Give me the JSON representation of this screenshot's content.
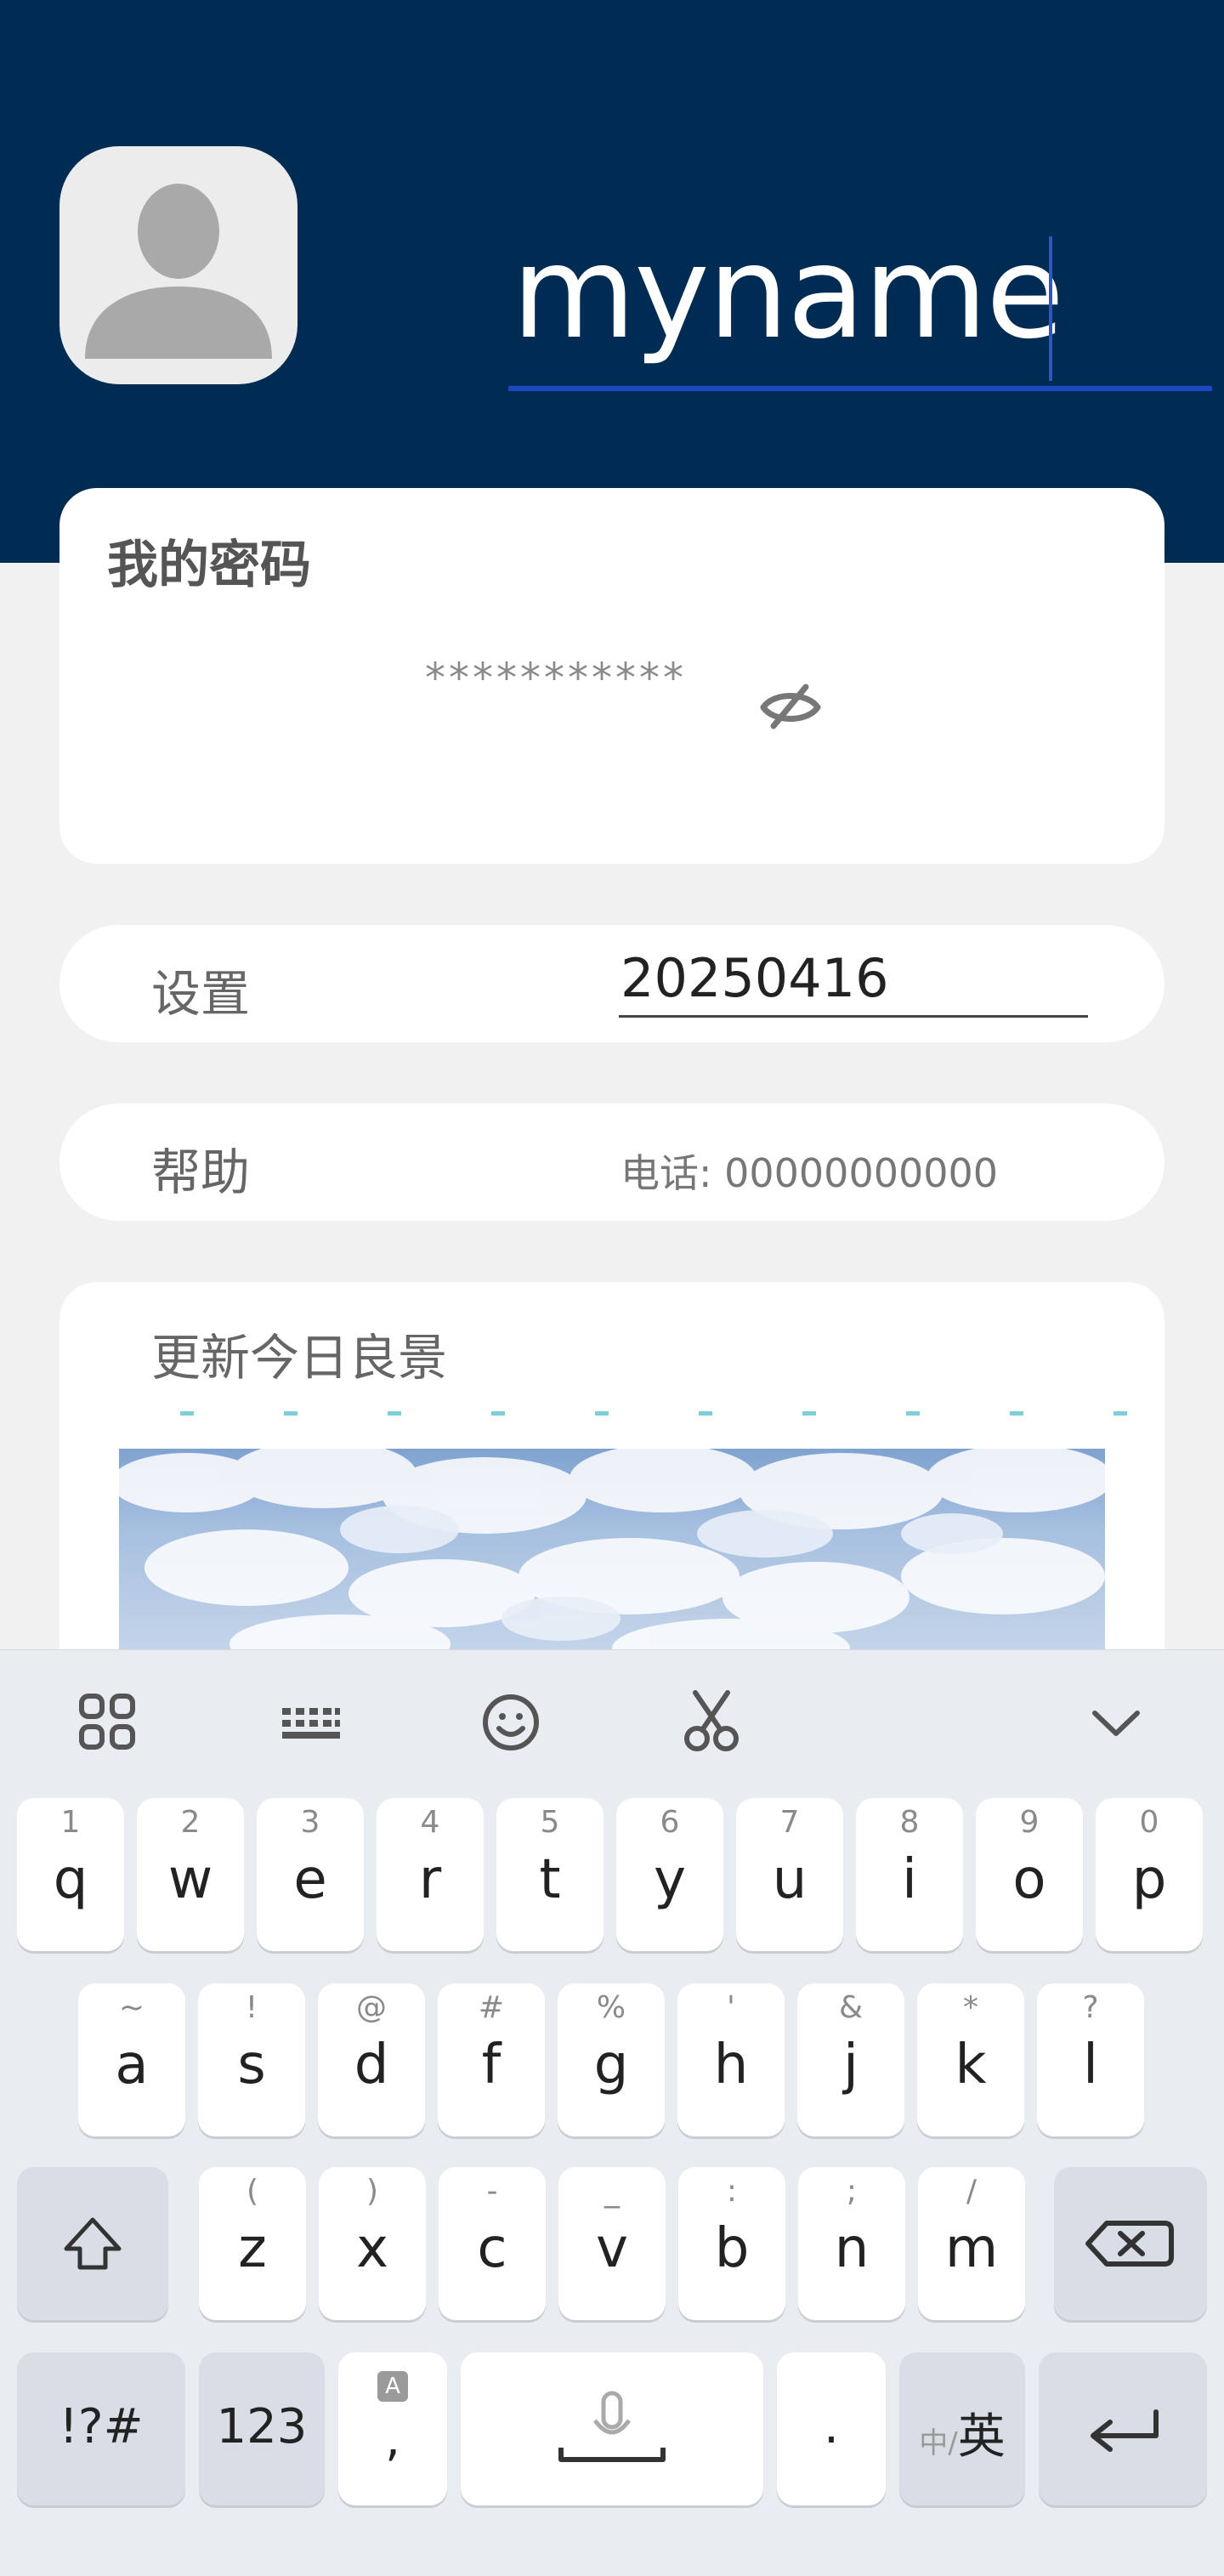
{
  "header": {
    "username": "myname"
  },
  "password_card": {
    "title": "我的密码",
    "masked_value": "***********"
  },
  "settings_row": {
    "label": "设置",
    "value": "20250416"
  },
  "help_row": {
    "label": "帮助",
    "phone": "电话: 00000000000"
  },
  "scenery_card": {
    "title": "更新今日良景"
  },
  "keyboard": {
    "toolbar": [
      "grid-menu-icon",
      "keyboard-layout-icon",
      "emoji-icon",
      "clipboard-scissors-icon",
      "collapse-keyboard-icon"
    ],
    "row1": [
      {
        "k": "q",
        "h": "1"
      },
      {
        "k": "w",
        "h": "2"
      },
      {
        "k": "e",
        "h": "3"
      },
      {
        "k": "r",
        "h": "4"
      },
      {
        "k": "t",
        "h": "5"
      },
      {
        "k": "y",
        "h": "6"
      },
      {
        "k": "u",
        "h": "7"
      },
      {
        "k": "i",
        "h": "8"
      },
      {
        "k": "o",
        "h": "9"
      },
      {
        "k": "p",
        "h": "0"
      }
    ],
    "row2": [
      {
        "k": "a",
        "h": "~"
      },
      {
        "k": "s",
        "h": "!"
      },
      {
        "k": "d",
        "h": "@"
      },
      {
        "k": "f",
        "h": "#"
      },
      {
        "k": "g",
        "h": "%"
      },
      {
        "k": "h",
        "h": "'"
      },
      {
        "k": "j",
        "h": "&"
      },
      {
        "k": "k",
        "h": "*"
      },
      {
        "k": "l",
        "h": "?"
      }
    ],
    "row3": [
      {
        "k": "z",
        "h": "("
      },
      {
        "k": "x",
        "h": ")"
      },
      {
        "k": "c",
        "h": "-"
      },
      {
        "k": "v",
        "h": "_"
      },
      {
        "k": "b",
        "h": ":"
      },
      {
        "k": "n",
        "h": ";"
      },
      {
        "k": "m",
        "h": "/"
      }
    ],
    "symbols_key": "!?#",
    "numbers_key": "123",
    "comma_key": ",",
    "comma_hint": "A",
    "period_key": ".",
    "lang_key_small": "中/",
    "lang_key_big": "英"
  }
}
